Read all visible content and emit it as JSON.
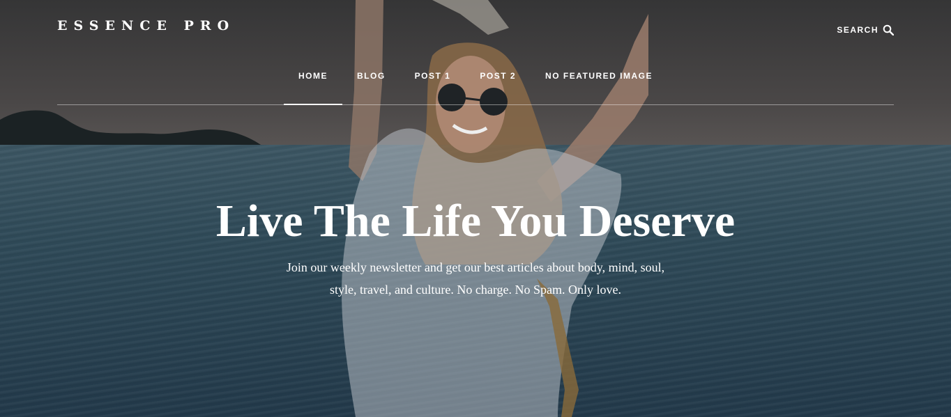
{
  "header": {
    "site_title": "ESSENCE PRO",
    "search_label": "SEARCH",
    "search_icon": "search-icon"
  },
  "nav": {
    "items": [
      {
        "label": "HOME",
        "active": true
      },
      {
        "label": "BLOG",
        "active": false
      },
      {
        "label": "POST 1",
        "active": false
      },
      {
        "label": "POST 2",
        "active": false
      },
      {
        "label": "NO FEATURED IMAGE",
        "active": false
      }
    ]
  },
  "hero": {
    "headline": "Live The Life You Deserve",
    "subtext_line1": "Join our weekly newsletter and get our best articles about body, mind, soul,",
    "subtext_line2": "style, travel, and culture. No charge. No Spam. Only love."
  },
  "colors": {
    "text": "#ffffff",
    "overlay": "#000000",
    "sea": "#2f4a58"
  }
}
